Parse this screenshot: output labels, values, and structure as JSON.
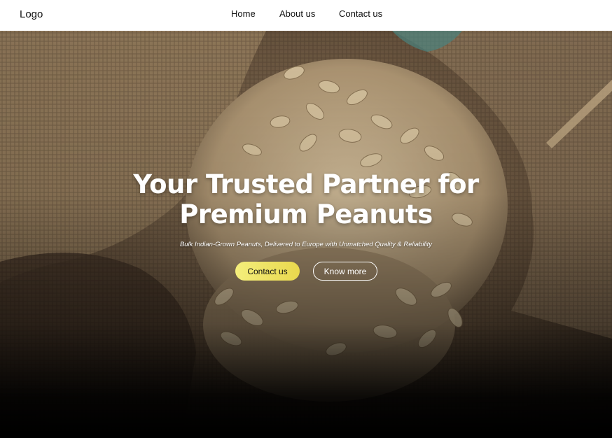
{
  "header": {
    "logo": "Logo",
    "nav": [
      {
        "label": "Home"
      },
      {
        "label": "About us"
      },
      {
        "label": "Contact us"
      }
    ]
  },
  "hero": {
    "title_line1": "Your Trusted Partner for",
    "title_line2": "Premium Peanuts",
    "subtitle": "Bulk Indian-Grown Peanuts, Delivered to Europe with Unmatched Quality & Reliability",
    "primary_button": "Contact us",
    "secondary_button": "Know more",
    "image_subject": "peanuts-in-jute-sack",
    "accent_color": "#ede267"
  }
}
